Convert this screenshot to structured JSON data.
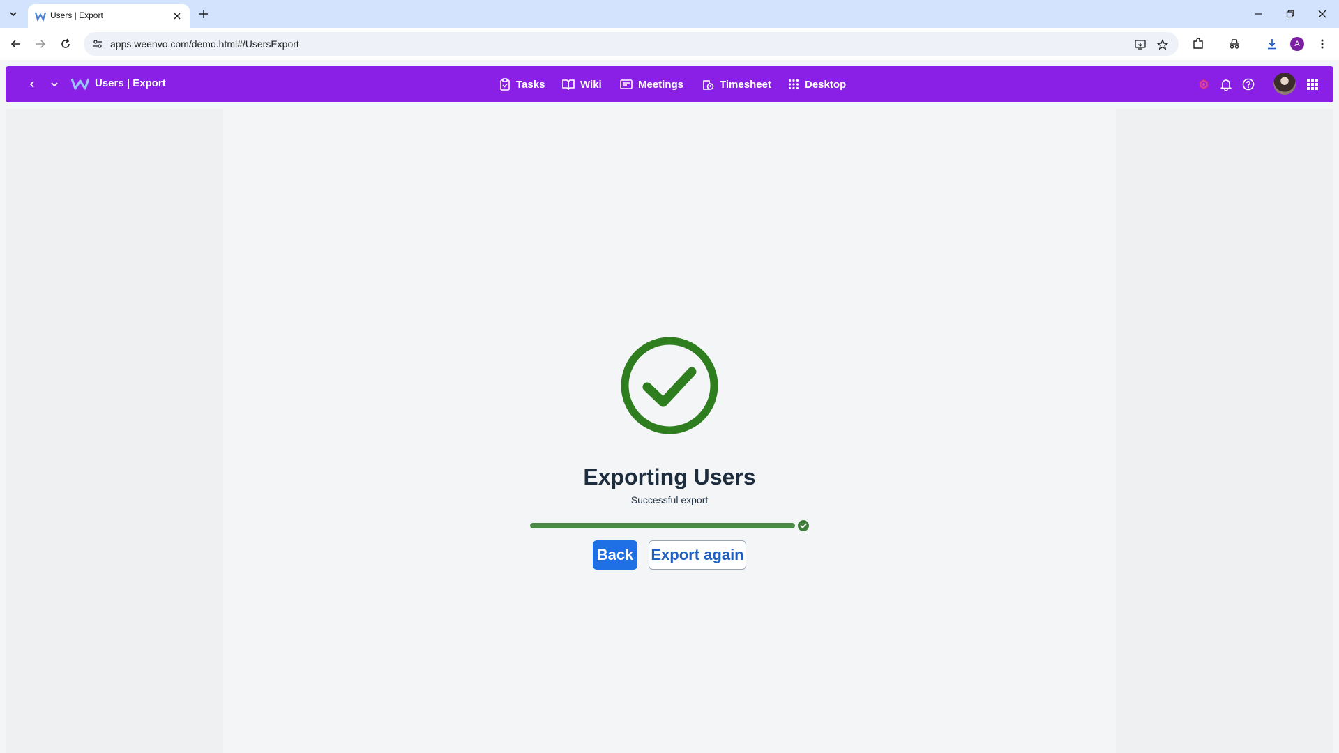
{
  "browser": {
    "tab_title": "Users | Export",
    "url": "apps.weenvo.com/demo.html#/UsersExport",
    "profile_initial": "A"
  },
  "appbar": {
    "title": "Users | Export",
    "nav": [
      {
        "label": "Tasks",
        "icon": "clipboard-icon"
      },
      {
        "label": "Wiki",
        "icon": "book-icon"
      },
      {
        "label": "Meetings",
        "icon": "meetings-icon"
      },
      {
        "label": "Timesheet",
        "icon": "timesheet-icon"
      },
      {
        "label": "Desktop",
        "icon": "grid-icon"
      }
    ]
  },
  "export": {
    "heading": "Exporting Users",
    "status": "Successful export",
    "progress": 1.0,
    "back_label": "Back",
    "again_label": "Export again"
  },
  "colors": {
    "appbar": "#8a1fe5",
    "success": "#2e7d1f",
    "primary_button": "#1f6fe5"
  }
}
